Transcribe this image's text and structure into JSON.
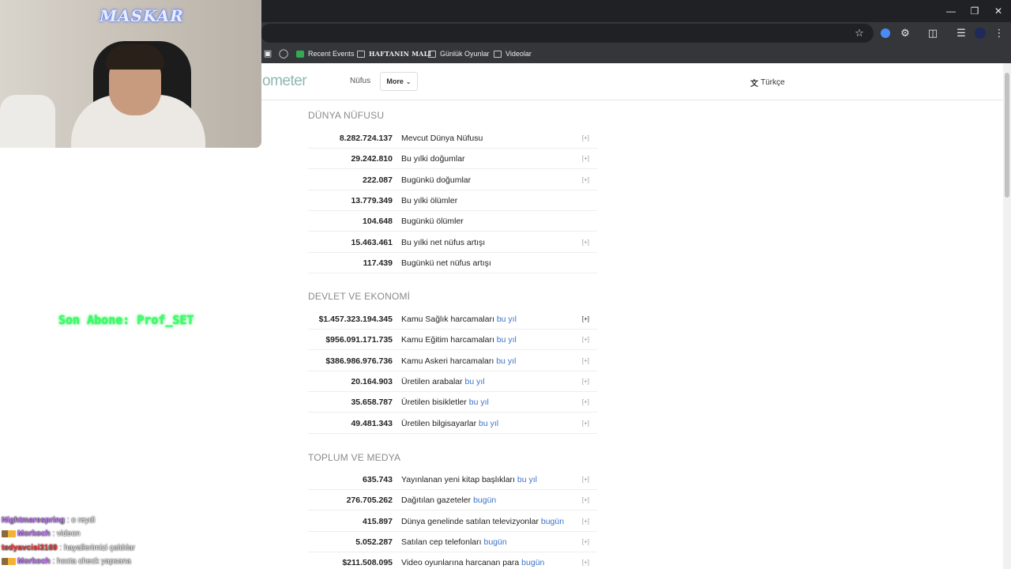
{
  "bookmarks": [
    {
      "label": "Recent Events",
      "icon": "green-app-icon"
    },
    {
      "label": "HAFTANIN MALI",
      "icon": "folder-icon"
    },
    {
      "label": "Günlük Oyunlar",
      "icon": "folder-icon"
    },
    {
      "label": "Videolar",
      "icon": "folder-icon"
    }
  ],
  "site": {
    "logo_suffix": "ometer",
    "nav_population": "Nüfus",
    "nav_more": "More",
    "language": "Türkçe"
  },
  "sections": {
    "population": {
      "title": "DÜNYA NÜFUSU",
      "rows": [
        {
          "value": "8.282.724.137",
          "label": "Mevcut Dünya Nüfusu",
          "suffix": "",
          "plus": "[+]"
        },
        {
          "value": "29.242.810",
          "label": "Bu yılki doğumlar",
          "suffix": "",
          "plus": "[+]"
        },
        {
          "value": "222.087",
          "label": "Bugünkü doğumlar",
          "suffix": "",
          "plus": "[+]"
        },
        {
          "value": "13.779.349",
          "label": "Bu yılki ölümler",
          "suffix": "",
          "plus": ""
        },
        {
          "value": "104.648",
          "label": "Bugünkü ölümler",
          "suffix": "",
          "plus": ""
        },
        {
          "value": "15.463.461",
          "label": "Bu yılki net nüfus artışı",
          "suffix": "",
          "plus": "[+]"
        },
        {
          "value": "117.439",
          "label": "Bugünkü net nüfus artışı",
          "suffix": "",
          "plus": ""
        }
      ]
    },
    "economy": {
      "title": "DEVLET VE EKONOMİ",
      "rows": [
        {
          "value": "$1.457.323.194.345",
          "label": "Kamu Sağlık harcamaları ",
          "suffix": "bu yıl",
          "plus": "[+]"
        },
        {
          "value": "$956.091.171.735",
          "label": "Kamu Eğitim harcamaları ",
          "suffix": "bu yıl",
          "plus": "[+]"
        },
        {
          "value": "$386.986.976.736",
          "label": "Kamu Askeri harcamaları ",
          "suffix": "bu yıl",
          "plus": "[+]"
        },
        {
          "value": "20.164.903",
          "label": "Üretilen arabalar ",
          "suffix": "bu yıl",
          "plus": "[+]"
        },
        {
          "value": "35.658.787",
          "label": "Üretilen bisikletler ",
          "suffix": "bu yıl",
          "plus": "[+]"
        },
        {
          "value": "49.481.343",
          "label": "Üretilen bilgisayarlar ",
          "suffix": "bu yıl",
          "plus": "[+]"
        }
      ]
    },
    "media": {
      "title": "TOPLUM VE MEDYA",
      "rows": [
        {
          "value": "635.743",
          "label": "Yayınlanan yeni kitap başlıkları ",
          "suffix": "bu yıl",
          "plus": "[+]"
        },
        {
          "value": "276.705.262",
          "label": "Dağıtılan gazeteler ",
          "suffix": "bugün",
          "plus": "[+]"
        },
        {
          "value": "415.897",
          "label": "Dünya genelinde satılan televizyonlar ",
          "suffix": "bugün",
          "plus": "[+]"
        },
        {
          "value": "5.052.287",
          "label": "Satılan cep telefonları ",
          "suffix": "bugün",
          "plus": "[+]"
        },
        {
          "value": "$211.508.095",
          "label": "Video oyunlarına harcanan para ",
          "suffix": "bugün",
          "plus": "[+]"
        }
      ]
    }
  },
  "overlay": {
    "streamer_name": "MASKAR",
    "last_sub": "Son Abone: Prof_SET",
    "chat": [
      {
        "user": "Nightmarespring",
        "msg": " : o reydi"
      },
      {
        "user": "Morkoch",
        "msg": " : videon"
      },
      {
        "user": "tedyavcisi3169",
        "msg": " : hayallerimizi çaldılar"
      },
      {
        "user": "Morkoch",
        "msg": " : hocta check yapsana"
      }
    ]
  }
}
